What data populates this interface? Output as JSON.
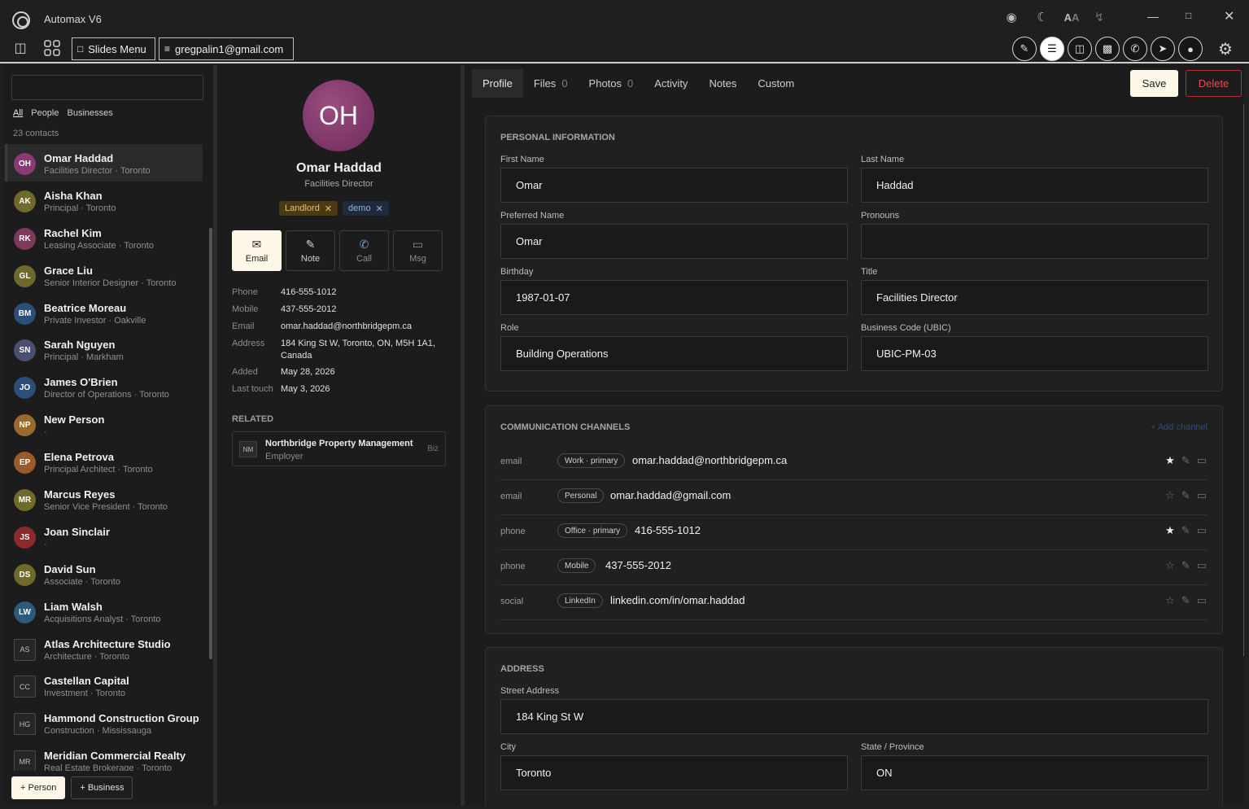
{
  "app": {
    "title": "Automax V6"
  },
  "toolbar": {
    "slides_label": "Slides Menu",
    "account": "gregpalin1@gmail.com"
  },
  "left": {
    "search_placeholder": "",
    "filters": [
      "All",
      "People",
      "Businesses"
    ],
    "count": "23 contacts",
    "contacts": [
      {
        "initials": "OH",
        "name": "Omar Haddad",
        "role": "Facilities Director",
        "city": "Toronto",
        "color": "#8a3a73",
        "square": false
      },
      {
        "initials": "AK",
        "name": "Aisha Khan",
        "role": "Principal",
        "city": "Toronto",
        "color": "#6f6a2a",
        "square": false
      },
      {
        "initials": "RK",
        "name": "Rachel Kim",
        "role": "Leasing Associate",
        "city": "Toronto",
        "color": "#7e3a5a",
        "square": false
      },
      {
        "initials": "GL",
        "name": "Grace Liu",
        "role": "Senior Interior Designer",
        "city": "Toronto",
        "color": "#6f6a2a",
        "square": false
      },
      {
        "initials": "BM",
        "name": "Beatrice Moreau",
        "role": "Private Investor",
        "city": "Oakville",
        "color": "#2c4f7a",
        "square": false
      },
      {
        "initials": "SN",
        "name": "Sarah Nguyen",
        "role": "Principal",
        "city": "Markham",
        "color": "#4a4f6f",
        "square": false
      },
      {
        "initials": "JO",
        "name": "James O'Brien",
        "role": "Director of Operations",
        "city": "Toronto",
        "color": "#2c4f7a",
        "square": false
      },
      {
        "initials": "NP",
        "name": "New Person",
        "role": "",
        "city": "",
        "color": "#9a6a2a",
        "square": false
      },
      {
        "initials": "EP",
        "name": "Elena Petrova",
        "role": "Principal Architect",
        "city": "Toronto",
        "color": "#9a5a2a",
        "square": false
      },
      {
        "initials": "MR",
        "name": "Marcus Reyes",
        "role": "Senior Vice President",
        "city": "Toronto",
        "color": "#6f6a2a",
        "square": false
      },
      {
        "initials": "JS",
        "name": "Joan Sinclair",
        "role": "",
        "city": "",
        "color": "#8a2a2a",
        "square": false
      },
      {
        "initials": "DS",
        "name": "David Sun",
        "role": "Associate",
        "city": "Toronto",
        "color": "#6f6a2a",
        "square": false
      },
      {
        "initials": "LW",
        "name": "Liam Walsh",
        "role": "Acquisitions Analyst",
        "city": "Toronto",
        "color": "#2c5a7a",
        "square": false
      },
      {
        "initials": "AS",
        "name": "Atlas Architecture Studio",
        "role": "Architecture",
        "city": "Toronto",
        "color": "#262626",
        "square": true
      },
      {
        "initials": "CC",
        "name": "Castellan Capital",
        "role": "Investment",
        "city": "Toronto",
        "color": "#262626",
        "square": true
      },
      {
        "initials": "HG",
        "name": "Hammond Construction Group",
        "role": "Construction",
        "city": "Mississauga",
        "color": "#262626",
        "square": true
      },
      {
        "initials": "MR",
        "name": "Meridian Commercial Realty",
        "role": "Real Estate Brokerage",
        "city": "Toronto",
        "color": "#262626",
        "square": true
      }
    ],
    "add_person": "+ Person",
    "add_business": "+ Business"
  },
  "profile": {
    "initials": "OH",
    "name": "Omar Haddad",
    "title": "Facilities Director",
    "tags": [
      "Landlord",
      "demo"
    ],
    "actions": [
      "Email",
      "Note",
      "Call",
      "Msg"
    ],
    "info": [
      {
        "k": "Phone",
        "v": "416-555-1012"
      },
      {
        "k": "Mobile",
        "v": "437-555-2012"
      },
      {
        "k": "Email",
        "v": "omar.haddad@northbridgepm.ca"
      },
      {
        "k": "Address",
        "v": "184 King St W, Toronto, ON, M5H 1A1, Canada"
      },
      {
        "k": "Added",
        "v": "May 28, 2026"
      },
      {
        "k": "Last touch",
        "v": "May 3, 2026"
      }
    ],
    "related_heading": "RELATED",
    "related": {
      "initials": "NM",
      "name": "Northbridge Property Management",
      "relation": "Employer",
      "kind": "Biz"
    }
  },
  "detail": {
    "tabs": [
      {
        "label": "Profile",
        "count": ""
      },
      {
        "label": "Files",
        "count": "0"
      },
      {
        "label": "Photos",
        "count": "0"
      },
      {
        "label": "Activity",
        "count": ""
      },
      {
        "label": "Notes",
        "count": ""
      },
      {
        "label": "Custom",
        "count": ""
      }
    ],
    "save": "Save",
    "delete": "Delete",
    "personal": {
      "heading": "PERSONAL INFORMATION",
      "first_name_label": "First Name",
      "first_name": "Omar",
      "last_name_label": "Last Name",
      "last_name": "Haddad",
      "preferred_label": "Preferred Name",
      "preferred": "Omar",
      "pronouns_label": "Pronouns",
      "pronouns": "",
      "birthday_label": "Birthday",
      "birthday": "1987-01-07",
      "title_label": "Title",
      "title": "Facilities Director",
      "role_label": "Role",
      "role": "Building Operations",
      "ubic_label": "Business Code (UBIC)",
      "ubic": "UBIC-PM-03"
    },
    "comms": {
      "heading": "COMMUNICATION CHANNELS",
      "add": "+ Add channel",
      "channels": [
        {
          "type": "email",
          "badge": "Work · primary",
          "value": "omar.haddad@northbridgepm.ca",
          "starred": true
        },
        {
          "type": "email",
          "badge": "Personal",
          "value": "omar.haddad@gmail.com",
          "starred": false
        },
        {
          "type": "phone",
          "badge": "Office · primary",
          "value": "416-555-1012",
          "starred": true
        },
        {
          "type": "phone",
          "badge": "Mobile",
          "value": "437-555-2012",
          "starred": false
        },
        {
          "type": "social",
          "badge": "LinkedIn",
          "value": "linkedin.com/in/omar.haddad",
          "starred": false
        }
      ]
    },
    "address": {
      "heading": "ADDRESS",
      "street_label": "Street Address",
      "street": "184 King St W",
      "city_label": "City",
      "city": "Toronto",
      "state_label": "State / Province",
      "state": "ON"
    }
  }
}
